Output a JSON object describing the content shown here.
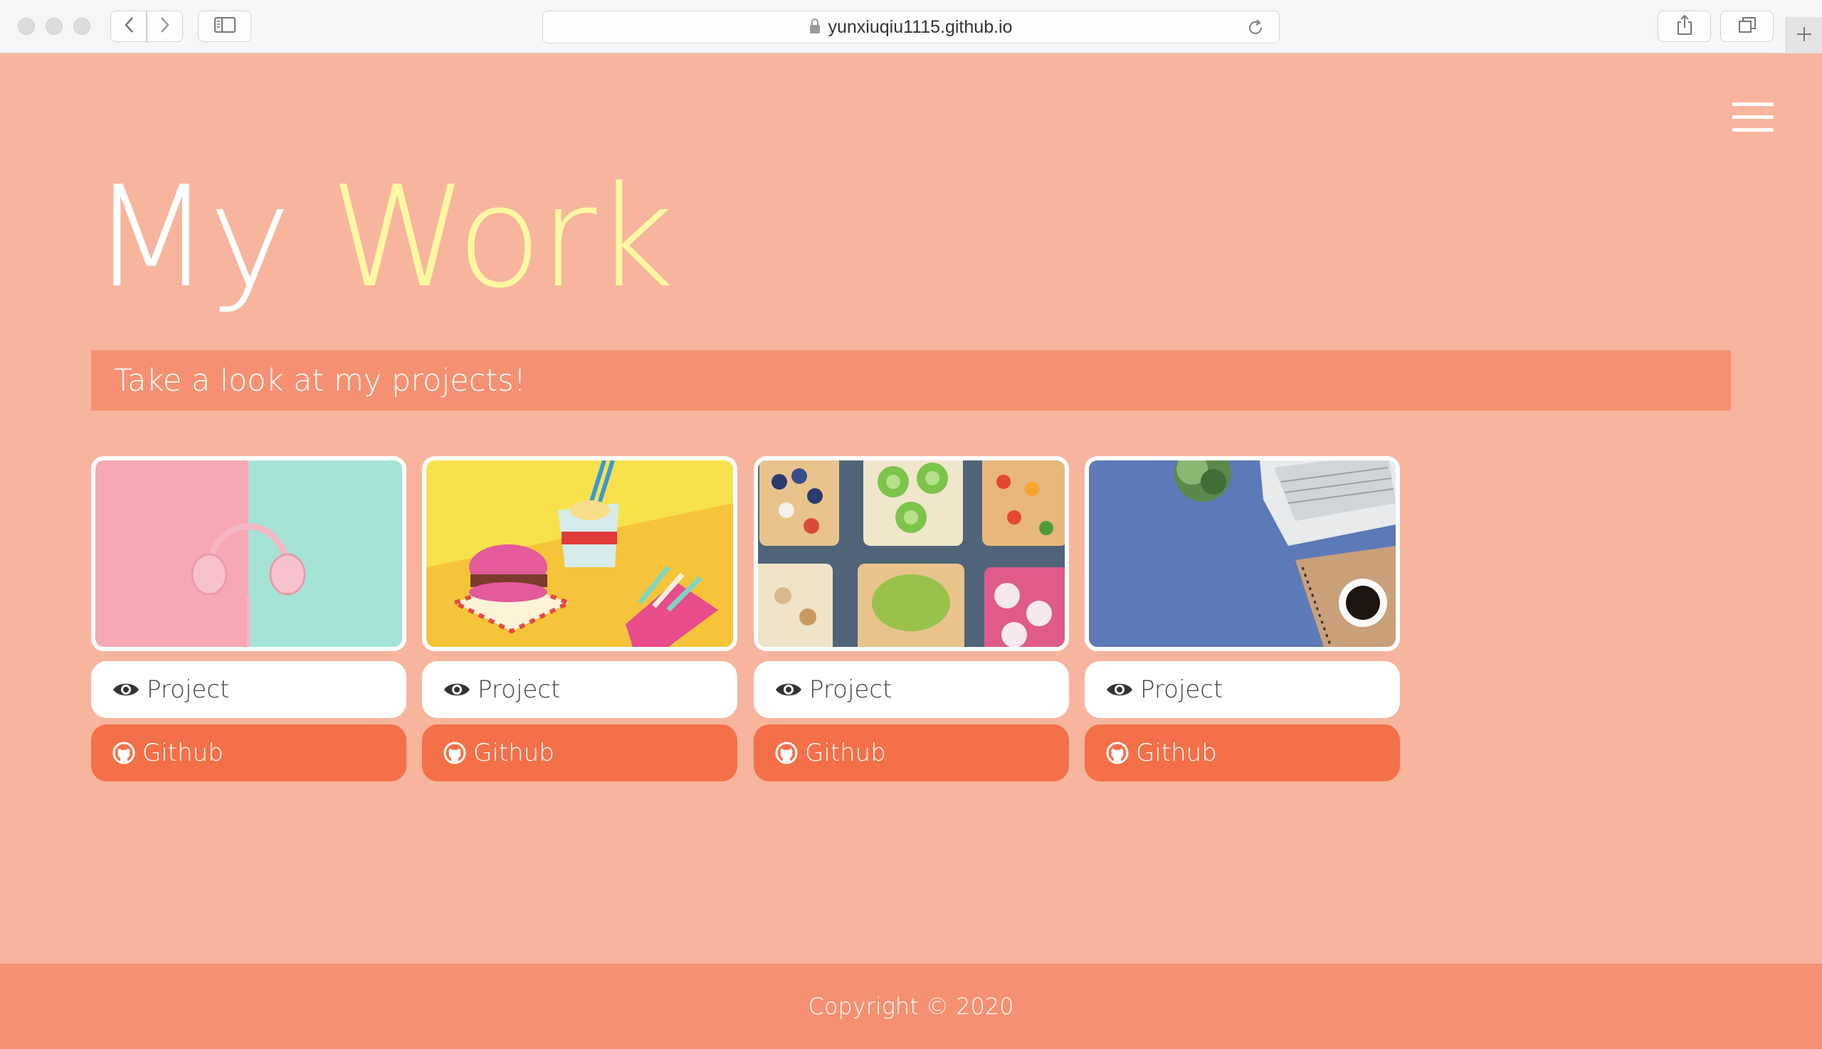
{
  "browser": {
    "url": "yunxiuqiu1115.github.io",
    "icons": [
      "back-icon",
      "forward-icon",
      "sidebar-icon",
      "lock-icon",
      "reload-icon",
      "share-icon",
      "tabs-icon",
      "plus-icon"
    ]
  },
  "nav": {
    "menu_icon": "hamburger-icon"
  },
  "header": {
    "title_first": "My",
    "title_accent": "Work",
    "subtitle": "Take a look at my projects!"
  },
  "colors": {
    "page_background": "#f8b59d",
    "subtitle_band": "#f59172",
    "title_accent": "#fff8a3",
    "github_button": "#f37048",
    "footer": "#f59172"
  },
  "projects": [
    {
      "image": "pastel pink headphones",
      "project_label": "Project",
      "github_label": "Github"
    },
    {
      "image": "paper burger, noodles and fries",
      "project_label": "Project",
      "github_label": "Github"
    },
    {
      "image": "fruit and avocado toasts",
      "project_label": "Project",
      "github_label": "Github"
    },
    {
      "image": "laptop, notebook and coffee on blue desk",
      "project_label": "Project",
      "github_label": "Github"
    }
  ],
  "footer": {
    "copyright": "Copyright © 2020"
  }
}
